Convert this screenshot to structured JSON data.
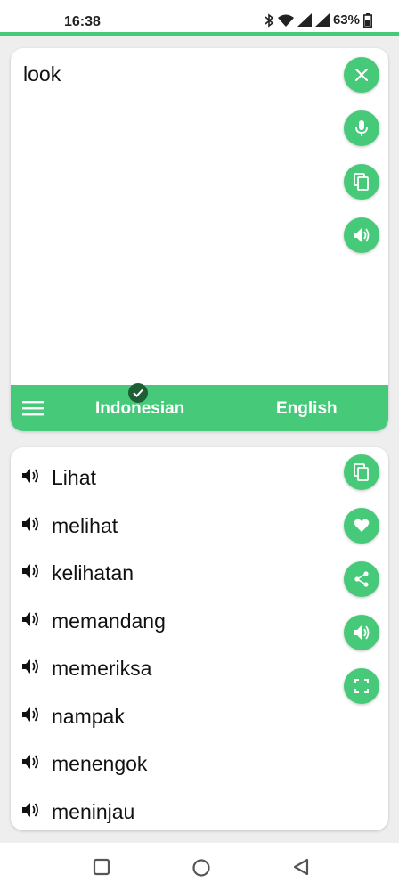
{
  "status": {
    "time": "16:38",
    "battery": "63%"
  },
  "input": {
    "text": "look"
  },
  "languages": {
    "source": "Indonesian",
    "target": "English"
  },
  "results": [
    {
      "word": "Lihat"
    },
    {
      "word": "melihat"
    },
    {
      "word": "kelihatan"
    },
    {
      "word": "memandang"
    },
    {
      "word": "memeriksa"
    },
    {
      "word": "nampak"
    },
    {
      "word": "menengok"
    },
    {
      "word": "meninjau"
    }
  ],
  "icons": {
    "input_actions": [
      "close-icon",
      "microphone-icon",
      "copy-icon",
      "speaker-icon"
    ],
    "output_actions": [
      "copy-icon",
      "heart-icon",
      "share-icon",
      "speaker-icon",
      "fullscreen-icon"
    ],
    "nav": [
      "recents-square-icon",
      "home-circle-icon",
      "back-triangle-icon"
    ]
  },
  "colors": {
    "accent": "#47c97a",
    "check_badge": "#1f5e34",
    "background": "#eeeeee"
  }
}
